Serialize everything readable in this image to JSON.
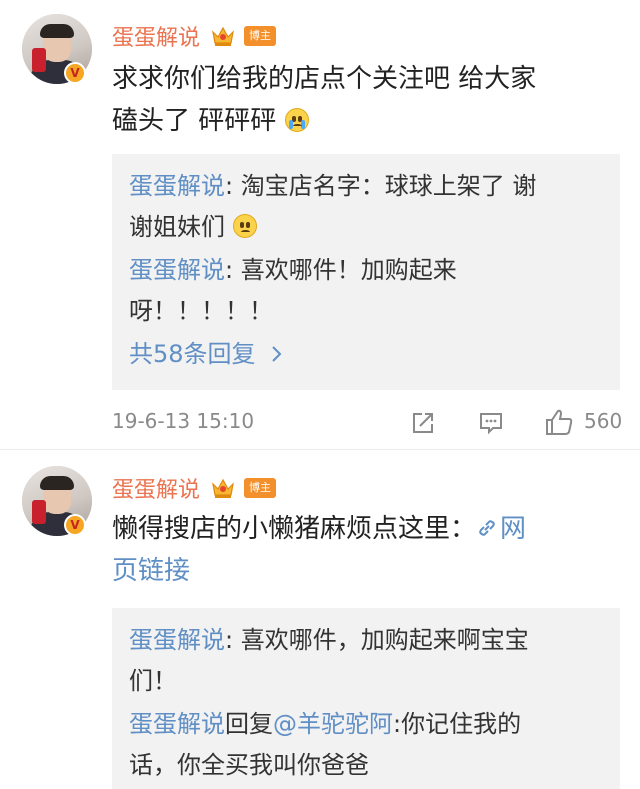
{
  "comments": [
    {
      "username": "蛋蛋解说",
      "tag": "博主",
      "verified_mark": "V",
      "content_line1": "求求你们给我的店点个关注吧 给大家",
      "content_line2": "磕头了 砰砰砰",
      "content_emoji": "crying-face-icon",
      "replies": [
        {
          "name": "蛋蛋解说",
          "text_line1": ": 淘宝店名字：球球上架了 谢",
          "text_line2": "谢姐妹们",
          "emoji": "sad-face-icon"
        },
        {
          "name": "蛋蛋解说",
          "text_line1": ": 喜欢哪件！加购起来",
          "text_line2": "呀！！！！！"
        }
      ],
      "more_replies": "共58条回复",
      "timestamp": "19-6-13 15:10",
      "likes": "560"
    },
    {
      "username": "蛋蛋解说",
      "tag": "博主",
      "verified_mark": "V",
      "content_line1": "懒得搜店的小懒猪麻烦点这里：",
      "link_text_a": "网",
      "link_text_b": "页链接",
      "replies": [
        {
          "name": "蛋蛋解说",
          "text_line1": ": 喜欢哪件，加购起来啊宝宝",
          "text_line2": "们！"
        },
        {
          "name": "蛋蛋解说",
          "reply_word": "回复",
          "mention": "@羊驼驼阿",
          "text_line1": ":你记住我的",
          "text_line2": "话，你全买我叫你爸爸"
        }
      ]
    }
  ],
  "colors": {
    "accent": "#eb7350",
    "link": "#5f8fc5",
    "tag": "#f3902b"
  }
}
